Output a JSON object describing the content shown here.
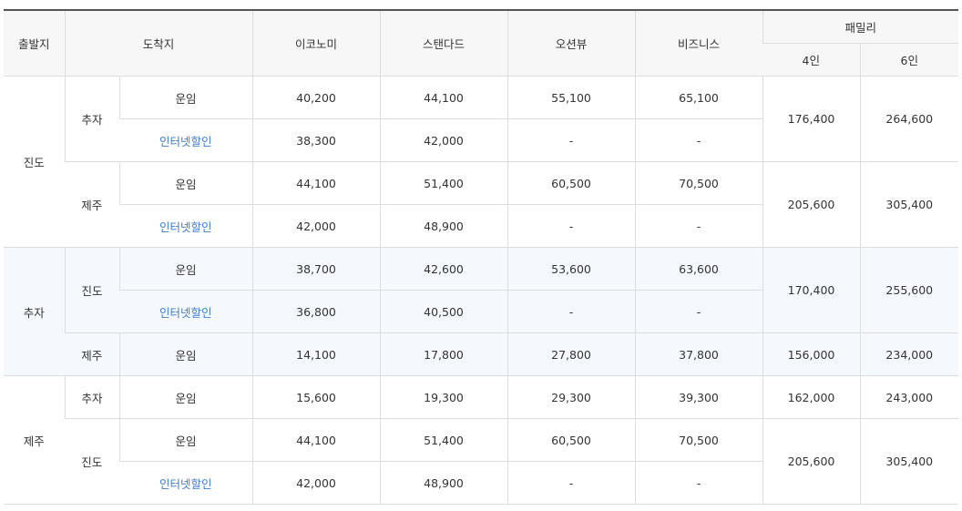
{
  "headers": {
    "departure": "출발지",
    "arrival": "도착지",
    "economy": "이코노미",
    "standard": "스탠다드",
    "ocean_view": "오션뷰",
    "business": "비즈니스",
    "family": "패밀리",
    "family_4": "4인",
    "family_6": "6인"
  },
  "groups": [
    {
      "departure": "진도",
      "routes": [
        {
          "arrival": "추자",
          "rows": [
            {
              "type": "운임",
              "economy": "40,200",
              "standard": "44,100",
              "ocean_view": "55,100",
              "business": "65,100"
            },
            {
              "type": "인터넷할인",
              "economy": "38,300",
              "standard": "42,000",
              "ocean_view": "-",
              "business": "-"
            }
          ],
          "family_4": "176,400",
          "family_6": "264,600"
        },
        {
          "arrival": "제주",
          "rows": [
            {
              "type": "운임",
              "economy": "44,100",
              "standard": "51,400",
              "ocean_view": "60,500",
              "business": "70,500"
            },
            {
              "type": "인터넷할인",
              "economy": "42,000",
              "standard": "48,900",
              "ocean_view": "-",
              "business": "-"
            }
          ],
          "family_4": "205,600",
          "family_6": "305,400"
        }
      ]
    },
    {
      "departure": "추자",
      "routes": [
        {
          "arrival": "진도",
          "rows": [
            {
              "type": "운임",
              "economy": "38,700",
              "standard": "42,600",
              "ocean_view": "53,600",
              "business": "63,600"
            },
            {
              "type": "인터넷할인",
              "economy": "36,800",
              "standard": "40,500",
              "ocean_view": "-",
              "business": "-"
            }
          ],
          "family_4": "170,400",
          "family_6": "255,600"
        },
        {
          "arrival": "제주",
          "rows": [
            {
              "type": "운임",
              "economy": "14,100",
              "standard": "17,800",
              "ocean_view": "27,800",
              "business": "37,800"
            }
          ],
          "family_4": "156,000",
          "family_6": "234,000"
        }
      ]
    },
    {
      "departure": "제주",
      "routes": [
        {
          "arrival": "추자",
          "rows": [
            {
              "type": "운임",
              "economy": "15,600",
              "standard": "19,300",
              "ocean_view": "29,300",
              "business": "39,300"
            }
          ],
          "family_4": "162,000",
          "family_6": "243,000"
        },
        {
          "arrival": "진도",
          "rows": [
            {
              "type": "운임",
              "economy": "44,100",
              "standard": "51,400",
              "ocean_view": "60,500",
              "business": "70,500"
            },
            {
              "type": "인터넷할인",
              "economy": "42,000",
              "standard": "48,900",
              "ocean_view": "-",
              "business": "-"
            }
          ],
          "family_4": "205,600",
          "family_6": "305,400"
        }
      ]
    }
  ]
}
